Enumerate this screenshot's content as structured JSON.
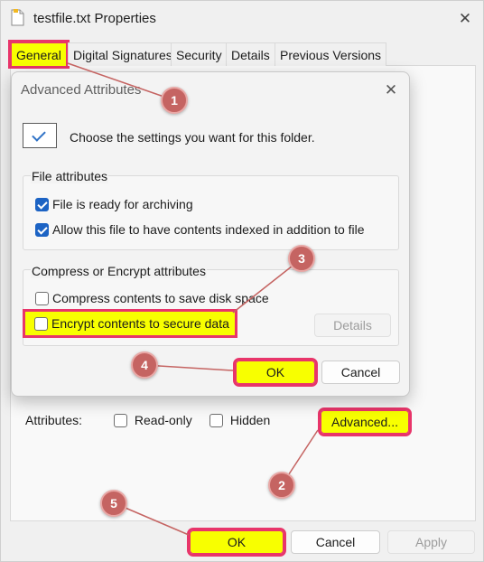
{
  "window": {
    "title": "testfile.txt Properties",
    "close_glyph": "✕"
  },
  "tabs": [
    {
      "label": "General"
    },
    {
      "label": "Digital Signatures"
    },
    {
      "label": "Security"
    },
    {
      "label": "Details"
    },
    {
      "label": "Previous Versions"
    }
  ],
  "general": {
    "attributes_label": "Attributes:",
    "readonly_label": "Read-only",
    "hidden_label": "Hidden",
    "advanced_button": "Advanced..."
  },
  "footer": {
    "ok": "OK",
    "cancel": "Cancel",
    "apply": "Apply"
  },
  "dialog": {
    "title": "Advanced Attributes",
    "close_glyph": "✕",
    "prompt": "Choose the settings you want for this folder.",
    "file_attributes": {
      "title": "File attributes",
      "archive_label": "File is ready for archiving",
      "index_label": "Allow this file to have contents indexed in addition to file"
    },
    "compress_encrypt": {
      "title": "Compress or Encrypt attributes",
      "compress_label": "Compress contents to save disk space",
      "encrypt_label": "Encrypt contents to secure data",
      "details_button": "Details"
    },
    "ok": "OK",
    "cancel": "Cancel"
  },
  "callouts": [
    "1",
    "2",
    "3",
    "4",
    "5"
  ],
  "colors": {
    "highlight": "#f8ff00",
    "highlight_border": "#e8356a",
    "callout": "#c56462",
    "checkbox": "#1c63c4"
  }
}
